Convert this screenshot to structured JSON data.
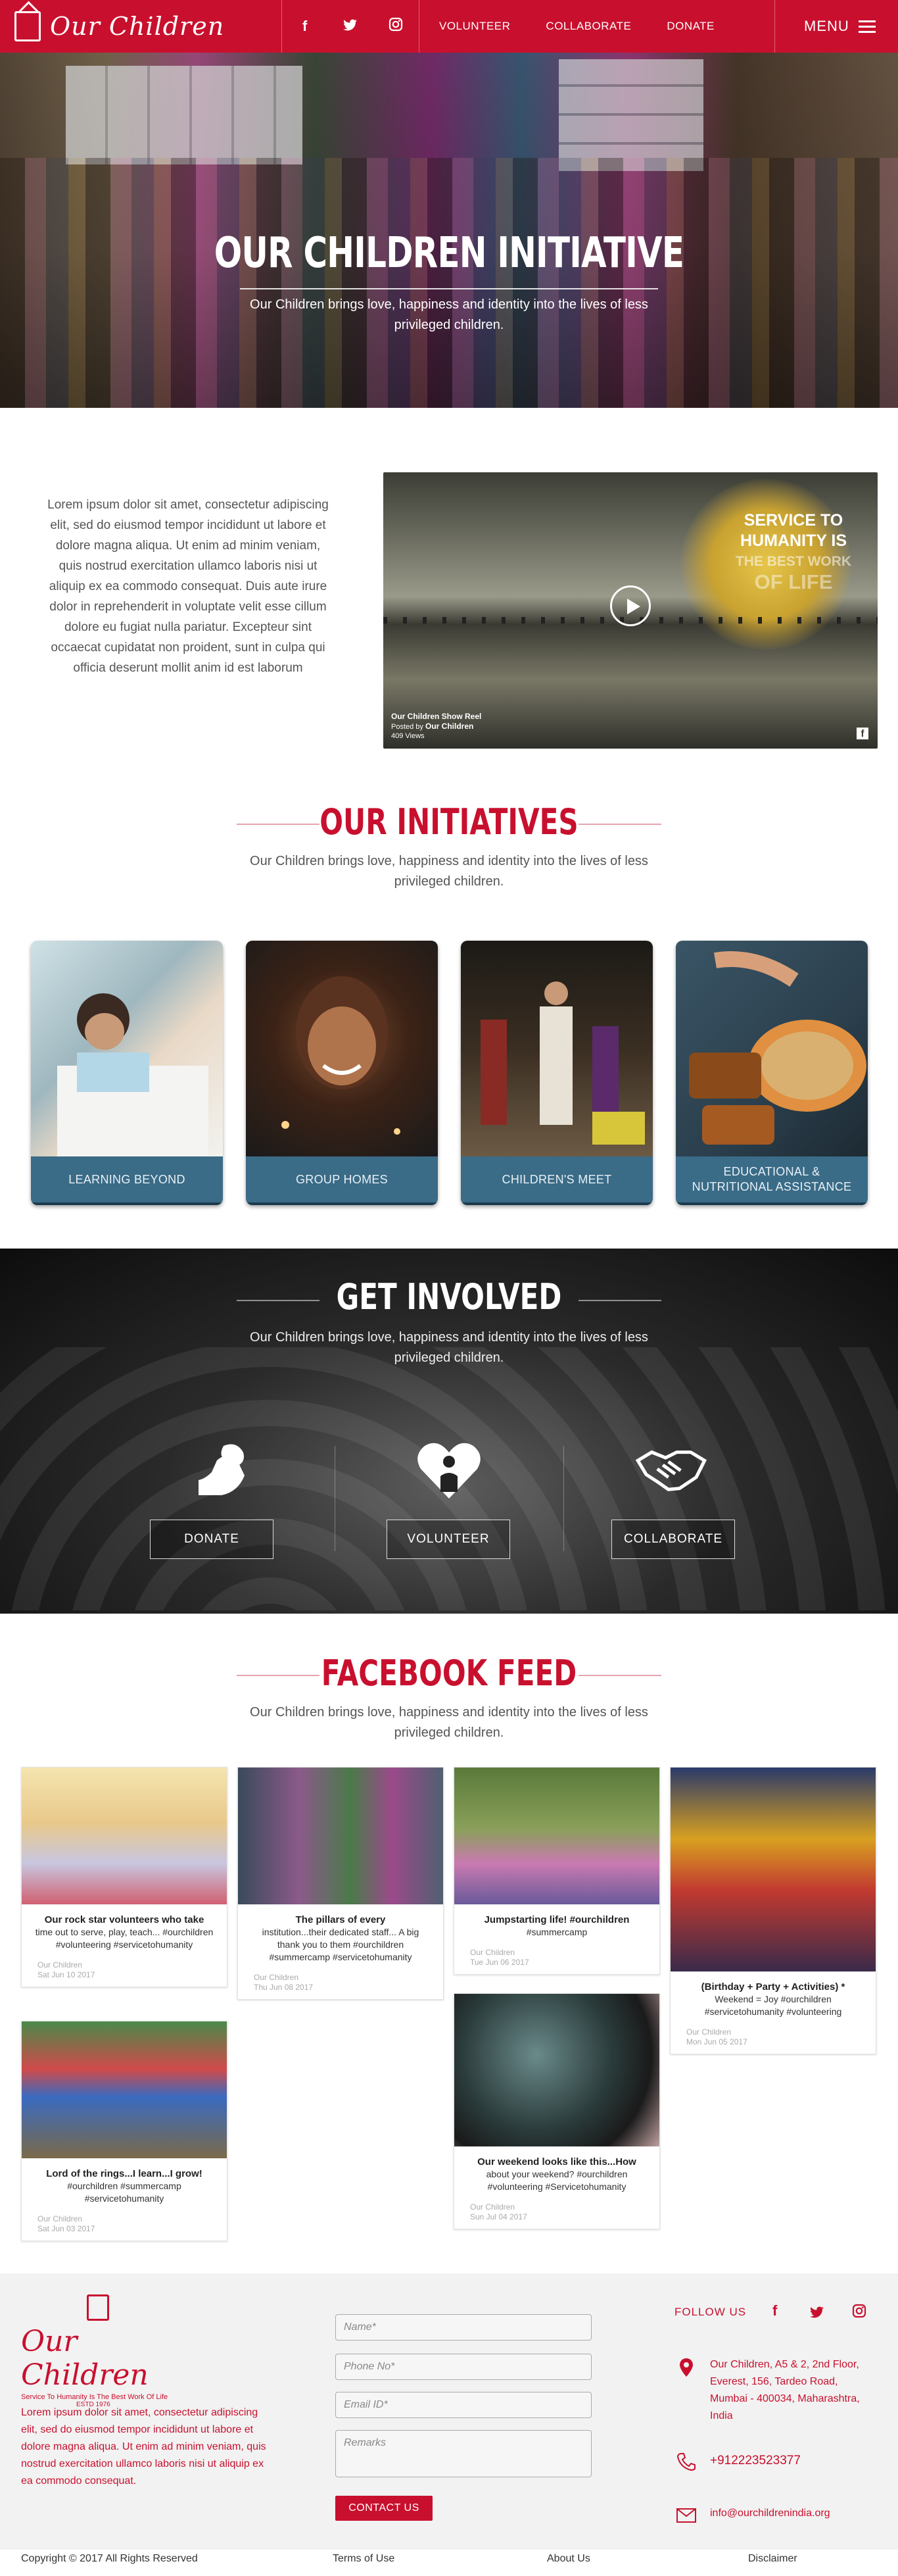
{
  "header": {
    "logo_text": "Our Children",
    "social": [
      "f",
      "t",
      "◎"
    ],
    "nav": [
      "VOLUNTEER",
      "COLLABORATE",
      "DONATE"
    ],
    "menu_label": "MENU"
  },
  "hero": {
    "title": "OUR CHILDREN INITIATIVE",
    "subtitle": "Our Children brings love, happiness and identity into the lives of less privileged children."
  },
  "intro": {
    "text": "Lorem ipsum dolor sit amet, consectetur adipiscing elit, sed do eiusmod tempor incididunt ut labore et dolore magna aliqua. Ut enim ad minim veniam, quis nostrud exercitation ullamco laboris nisi ut aliquip ex ea commodo consequat. Duis aute irure dolor in reprehenderit in voluptate velit esse cillum dolore eu fugiat nulla pariatur. Excepteur sint occaecat cupidatat non proident, sunt in culpa qui officia deserunt mollit anim id est laborum"
  },
  "video": {
    "overlay": [
      "SERVICE TO",
      "HUMANITY IS",
      "THE BEST WORK",
      "OF LIFE"
    ],
    "title": "Our Children Show Reel",
    "posted_by_label": "Posted by",
    "posted_by": "Our Children",
    "views": "409 Views"
  },
  "initiatives": {
    "title": "OUR INITIATIVES",
    "subtitle": "Our Children brings love, happiness and identity into the lives of less privileged children.",
    "items": [
      {
        "label": "LEARNING BEYOND"
      },
      {
        "label": "GROUP HOMES"
      },
      {
        "label": "CHILDREN'S MEET"
      },
      {
        "label": "EDUCATIONAL & NUTRITIONAL ASSISTANCE"
      }
    ]
  },
  "involved": {
    "title": "GET INVOLVED",
    "subtitle": "Our Children brings love, happiness and identity into the lives of less privileged children.",
    "buttons": [
      "DONATE",
      "VOLUNTEER",
      "COLLABORATE"
    ]
  },
  "feed": {
    "title": "FACEBOOK FEED",
    "subtitle": "Our Children brings love, happiness and identity into the lives of less privileged children.",
    "posts": [
      {
        "title": "Our rock star volunteers who take",
        "text": "time out to serve, play, teach... #ourchildren #volunteering #servicetohumanity",
        "by": "Our Children",
        "date": "Sat Jun 10 2017"
      },
      {
        "title": "The pillars of every",
        "text": "institution...their dedicated staff... A big thank you to them #ourchildren #summercamp #servicetohumanity",
        "by": "Our Children",
        "date": "Thu Jun 08 2017"
      },
      {
        "title": "Jumpstarting life! #ourchildren",
        "text": "#summercamp",
        "by": "Our Children",
        "date": "Tue Jun 06 2017"
      },
      {
        "title": "(Birthday + Party + Activities) *",
        "text": "Weekend = Joy #ourchildren #servicetohumanity #volunteering",
        "by": "Our Children",
        "date": "Mon Jun 05 2017"
      },
      {
        "title": "Lord of the rings...I learn...I grow!",
        "text": "#ourchildren #summercamp #servicetohumanity",
        "by": "Our Children",
        "date": "Sat Jun 03 2017"
      },
      {
        "title": "Our weekend looks like this...How",
        "text": "about your weekend? #ourchildren #volunteering #Servicetohumanity",
        "by": "Our Children",
        "date": "Sun Jul 04 2017"
      }
    ]
  },
  "footer": {
    "logo_text": "Our Children",
    "tagline": "Service To Humanity Is The Best Work Of Life",
    "estd": "ESTD 1976",
    "about": "Lorem ipsum dolor sit amet, consectetur adipiscing elit, sed do eiusmod tempor incididunt ut labore et dolore magna aliqua. Ut enim ad minim veniam, quis nostrud exercitation ullamco laboris nisi ut aliquip ex ea commodo consequat.",
    "form": {
      "name": "Name*",
      "phone": "Phone No*",
      "email": "Email ID*",
      "remarks": "Remarks",
      "submit": "CONTACT US"
    },
    "follow_label": "FOLLOW US",
    "social": [
      "f",
      "t",
      "◎"
    ],
    "address": "Our Children, A5 & 2, 2nd Floor, Everest, 156, Tardeo Road, Mumbai - 400034, Maharashtra, India",
    "phone": "+912223523377",
    "email": "info@ourchildrenindia.org",
    "copyright": "Copyright © 2017 All Rights Reserved",
    "links": [
      "Terms of Use",
      "About Us",
      "Disclaimer"
    ]
  }
}
